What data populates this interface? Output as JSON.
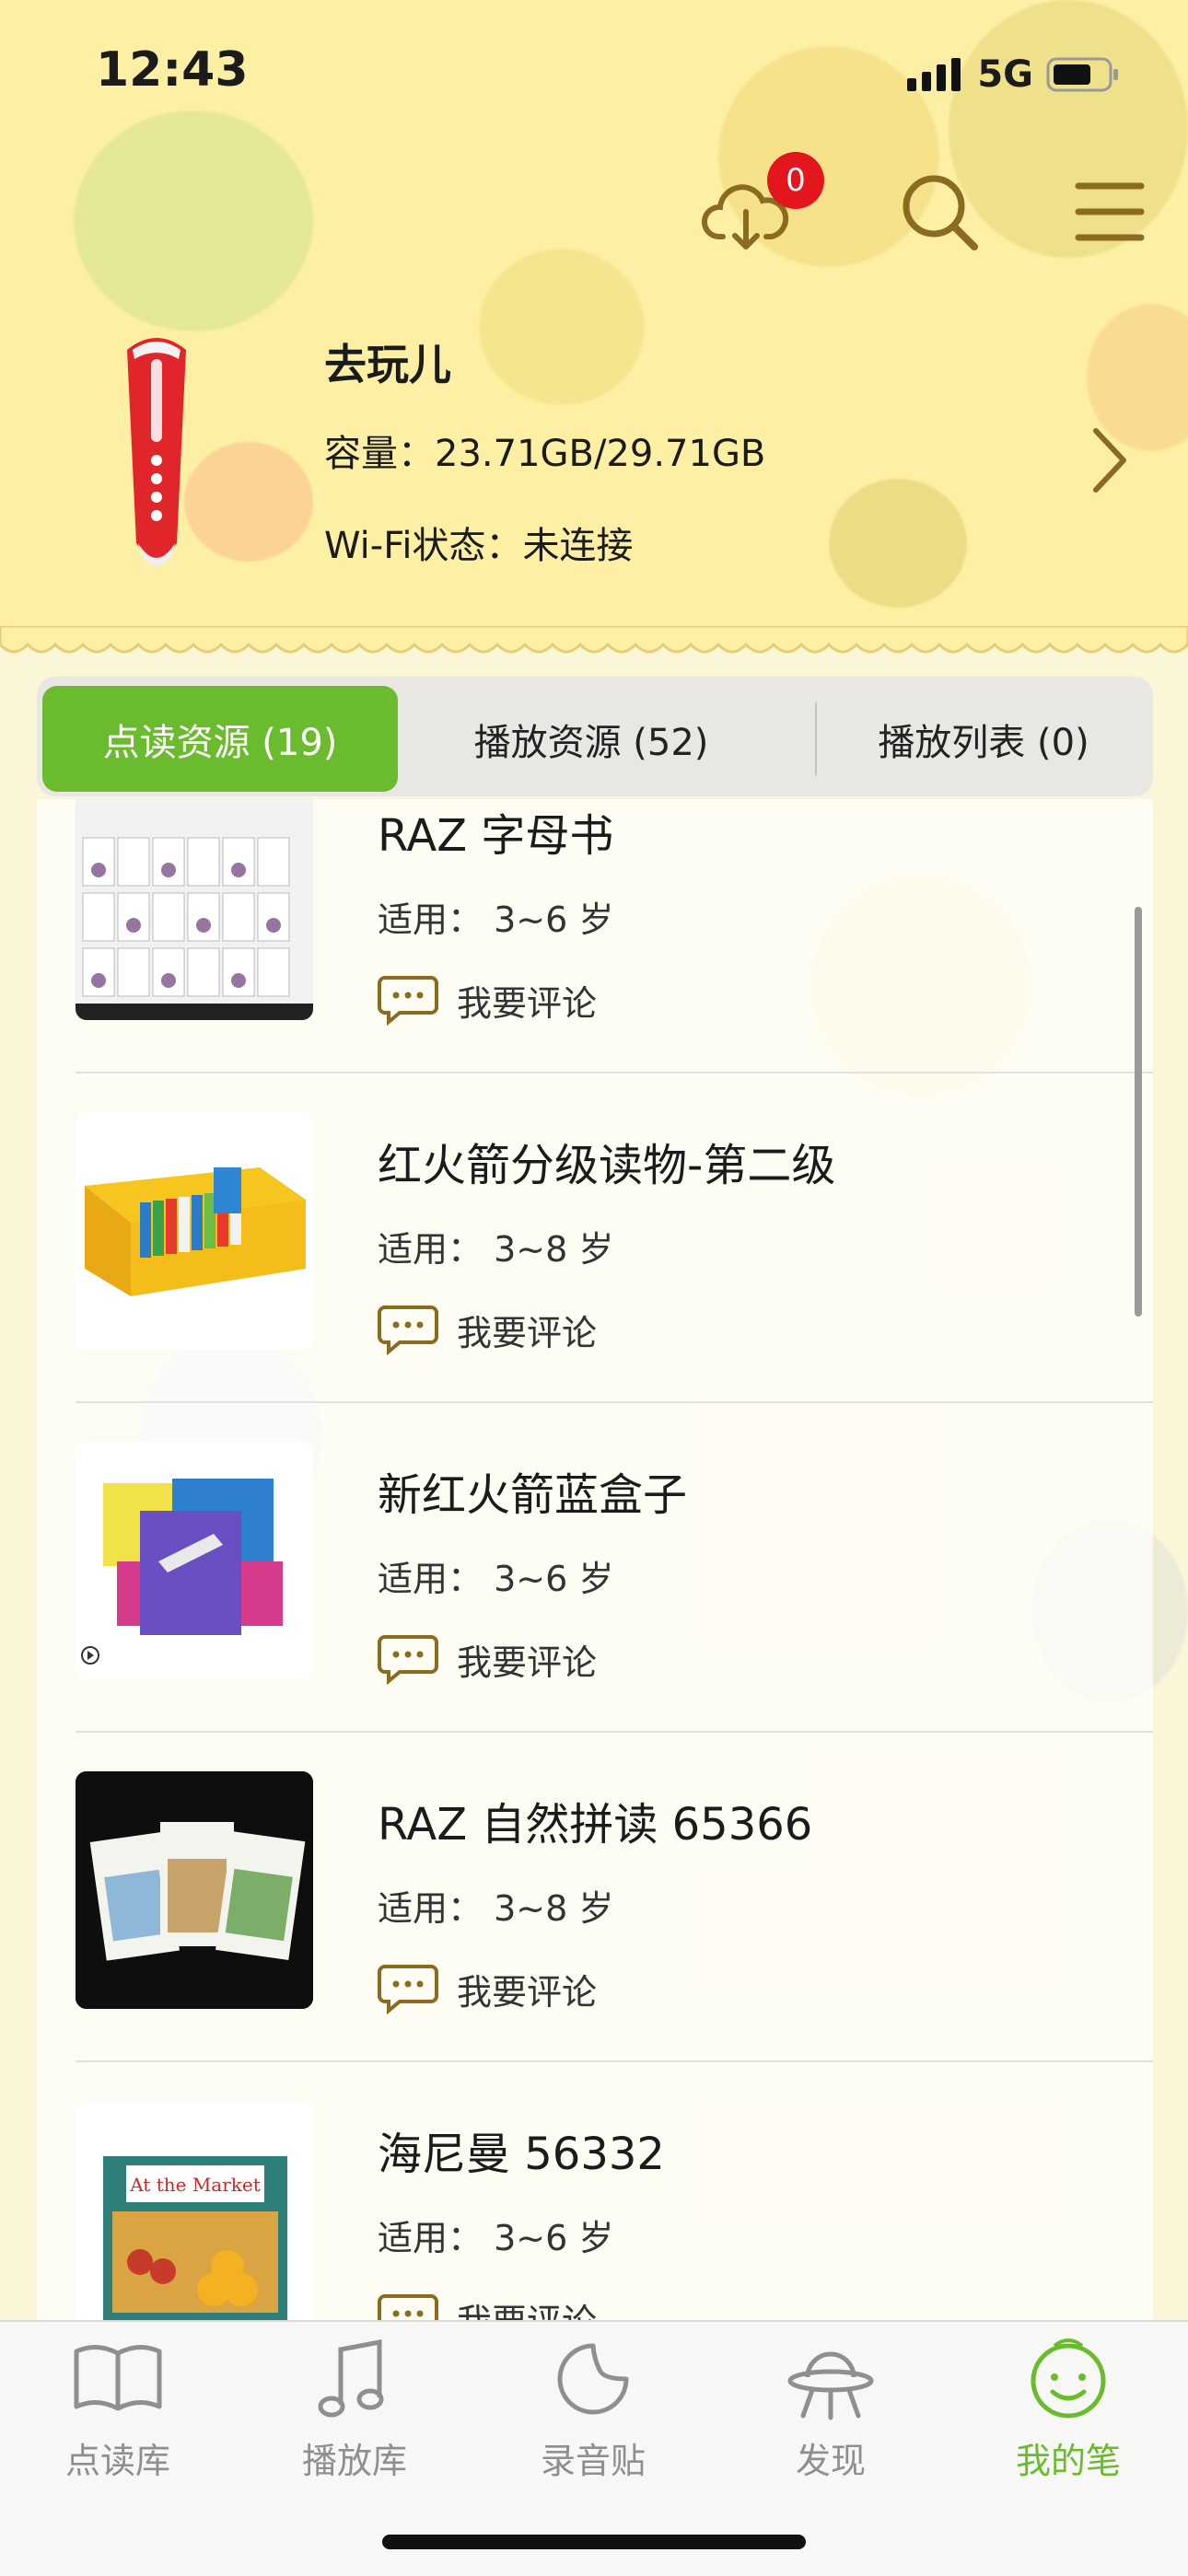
{
  "status_bar": {
    "time": "12:43",
    "network": "5G"
  },
  "header": {
    "download_badge": "0"
  },
  "device": {
    "name": "去玩儿",
    "capacity_label": "容量：",
    "capacity_value": "23.71GB/29.71GB",
    "wifi_label": "Wi-Fi状态：",
    "wifi_value": "未连接"
  },
  "tabs": [
    {
      "label": "点读资源 (19)",
      "active": true
    },
    {
      "label": "播放资源 (52)",
      "active": false
    },
    {
      "label": "播放列表 (0)",
      "active": false
    }
  ],
  "resources": [
    {
      "title": "RAZ 字母书",
      "age": "适用：  3~6 岁",
      "comment": "我要评论"
    },
    {
      "title": "红火箭分级读物-第二级",
      "age": "适用：  3~8 岁",
      "comment": "我要评论"
    },
    {
      "title": "新红火箭蓝盒子",
      "age": "适用：  3~6 岁",
      "comment": "我要评论"
    },
    {
      "title": "RAZ 自然拼读 65366",
      "age": "适用：  3~8 岁",
      "comment": "我要评论"
    },
    {
      "title": "海尼曼 56332",
      "age": "适用：  3~6 岁",
      "comment": "我要评论"
    }
  ],
  "thumbnail_text": {
    "market": "At the Market"
  },
  "tabbar": [
    {
      "label": "点读库",
      "icon": "book-icon",
      "active": false
    },
    {
      "label": "播放库",
      "icon": "music-note-icon",
      "active": false
    },
    {
      "label": "录音贴",
      "icon": "sticker-icon",
      "active": false
    },
    {
      "label": "发现",
      "icon": "ufo-icon",
      "active": false
    },
    {
      "label": "我的笔",
      "icon": "smiley-icon",
      "active": true
    }
  ],
  "colors": {
    "accent": "#6bbb2e",
    "badge": "#e3151d",
    "header_bg": "#fdf0a4",
    "icon_brown": "#8a6b1f"
  }
}
